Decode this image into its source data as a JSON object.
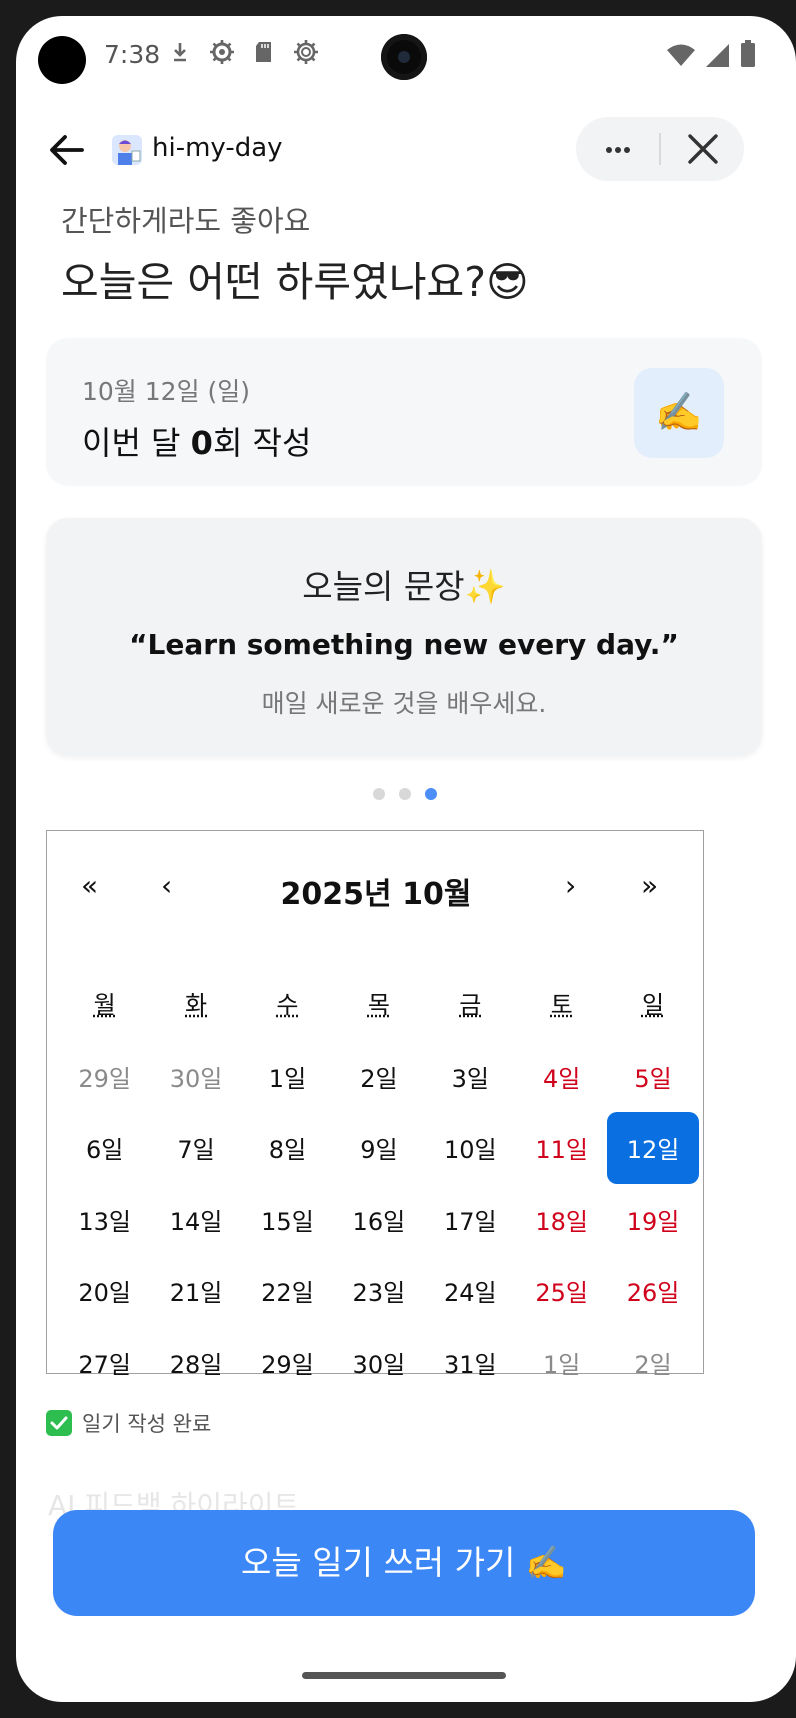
{
  "status_bar": {
    "time": "7:38"
  },
  "app_bar": {
    "title": "hi-my-day"
  },
  "greeting": {
    "subtitle": "간단하게라도 좋아요",
    "title": "오늘은 어떤 하루였나요?😎"
  },
  "summary": {
    "date": "10월 12일 (일)",
    "count_prefix": "이번 달 ",
    "count": "0",
    "count_suffix": "회 작성",
    "icon": "✍️"
  },
  "quote": {
    "title": "오늘의 문장✨",
    "english": "“Learn something new every day.”",
    "korean": "매일 새로운 것을 배우세요.",
    "page_count": 3,
    "active_page": 3
  },
  "calendar": {
    "month_label": "2025년 10월",
    "nav": {
      "prev_year": "«",
      "prev_month": "‹",
      "next_month": "›",
      "next_year": "»"
    },
    "weekdays": [
      "월",
      "화",
      "수",
      "목",
      "금",
      "토",
      "일"
    ],
    "days": [
      {
        "label": "29일",
        "state": "muted"
      },
      {
        "label": "30일",
        "state": "muted"
      },
      {
        "label": "1일",
        "state": "normal"
      },
      {
        "label": "2일",
        "state": "normal"
      },
      {
        "label": "3일",
        "state": "normal"
      },
      {
        "label": "4일",
        "state": "weekend"
      },
      {
        "label": "5일",
        "state": "weekend"
      },
      {
        "label": "6일",
        "state": "normal"
      },
      {
        "label": "7일",
        "state": "normal"
      },
      {
        "label": "8일",
        "state": "normal"
      },
      {
        "label": "9일",
        "state": "normal"
      },
      {
        "label": "10일",
        "state": "normal"
      },
      {
        "label": "11일",
        "state": "weekend"
      },
      {
        "label": "12일",
        "state": "selected"
      },
      {
        "label": "13일",
        "state": "normal"
      },
      {
        "label": "14일",
        "state": "normal"
      },
      {
        "label": "15일",
        "state": "normal"
      },
      {
        "label": "16일",
        "state": "normal"
      },
      {
        "label": "17일",
        "state": "normal"
      },
      {
        "label": "18일",
        "state": "weekend"
      },
      {
        "label": "19일",
        "state": "weekend"
      },
      {
        "label": "20일",
        "state": "normal"
      },
      {
        "label": "21일",
        "state": "normal"
      },
      {
        "label": "22일",
        "state": "normal"
      },
      {
        "label": "23일",
        "state": "normal"
      },
      {
        "label": "24일",
        "state": "normal"
      },
      {
        "label": "25일",
        "state": "weekend"
      },
      {
        "label": "26일",
        "state": "weekend"
      },
      {
        "label": "27일",
        "state": "normal"
      },
      {
        "label": "28일",
        "state": "normal"
      },
      {
        "label": "29일",
        "state": "normal"
      },
      {
        "label": "30일",
        "state": "normal"
      },
      {
        "label": "31일",
        "state": "normal"
      },
      {
        "label": "1일",
        "state": "muted"
      },
      {
        "label": "2일",
        "state": "muted"
      }
    ]
  },
  "legend": {
    "label": "일기 작성 완료"
  },
  "faded_section": {
    "label": "AI 피드백 하이라이트"
  },
  "cta": {
    "label": "오늘 일기 쓰러 가기 ✍️"
  },
  "colors": {
    "accent": "#3b87f6",
    "selected_day": "#0a6fe0",
    "weekend": "#d0021b",
    "check": "#2dbe4f"
  }
}
